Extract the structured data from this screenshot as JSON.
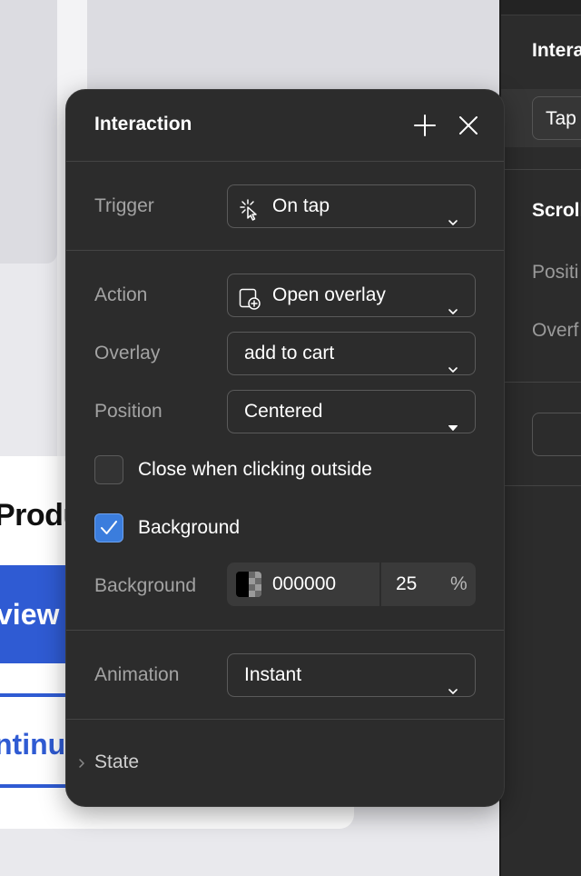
{
  "canvas": {
    "product_title": "Produ",
    "view_button_label": "view",
    "continue_button_label": "ntinu"
  },
  "inspector": {
    "title": "Intera",
    "trigger_value": "Tap",
    "scroll_heading": "Scroll",
    "position_label": "Positi",
    "overflow_label": "Overf"
  },
  "popover": {
    "title": "Interaction",
    "trigger": {
      "label": "Trigger",
      "value": "On tap",
      "icon": "tap-cursor-icon"
    },
    "action": {
      "label": "Action",
      "value": "Open overlay",
      "icon": "open-overlay-icon"
    },
    "overlay": {
      "label": "Overlay",
      "value": "add to cart"
    },
    "position": {
      "label": "Position",
      "value": "Centered"
    },
    "close_outside": {
      "label": "Close when clicking outside",
      "checked": false
    },
    "background_toggle": {
      "label": "Background",
      "checked": true
    },
    "background_color": {
      "label": "Background",
      "hex": "000000",
      "opacity": "25",
      "unit": "%"
    },
    "animation": {
      "label": "Animation",
      "value": "Instant"
    },
    "state": {
      "label": "State"
    }
  },
  "colors": {
    "panel_bg": "#2c2c2c",
    "accent": "#3b7ddd",
    "canvas_button": "#2f5bd3"
  }
}
